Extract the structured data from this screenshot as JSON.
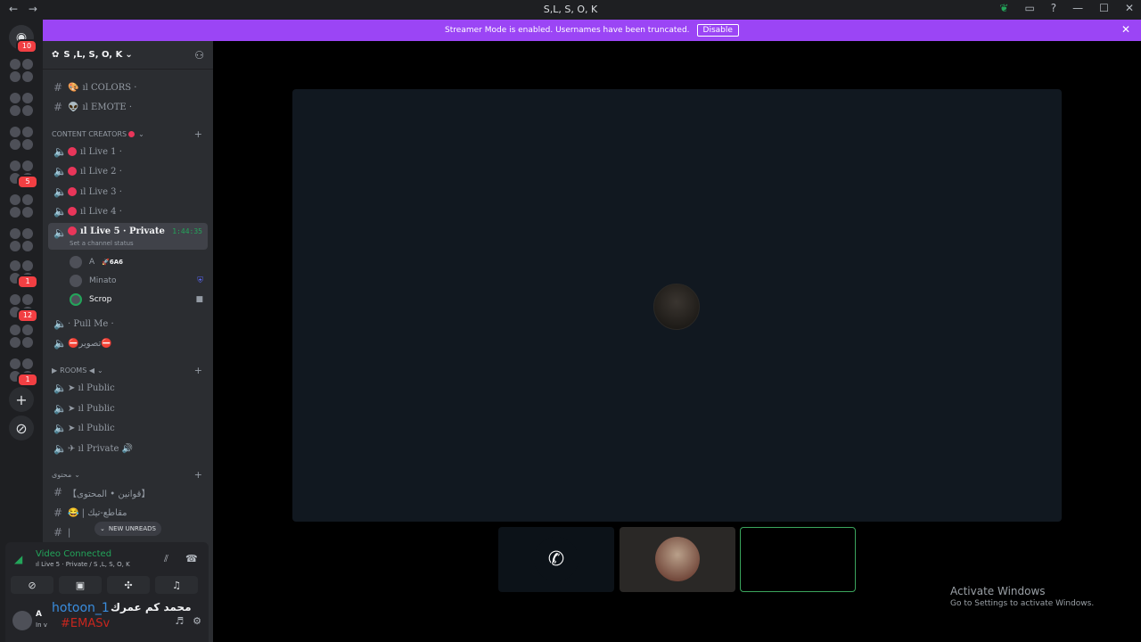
{
  "titlebar": {
    "back": "←",
    "forward": "→",
    "title": "S,L, S, O, K",
    "icons": [
      "leaf-icon",
      "inbox-icon",
      "help-icon"
    ],
    "window_controls": [
      "—",
      "☐",
      "✕"
    ]
  },
  "server_rail": {
    "home_badge": "10",
    "badges": [
      "5",
      "1",
      "12",
      "1"
    ]
  },
  "banner": {
    "text": "Streamer Mode is enabled. Usernames have been truncated.",
    "button": "Disable",
    "close": "✕"
  },
  "server": {
    "name": "S ,L, S, O, K",
    "chevron": "⌄"
  },
  "channels": {
    "text_top": [
      {
        "emoji": "🎨",
        "name": "ıl COLORS ·"
      },
      {
        "emoji": "👽",
        "name": "ıl EMOTE ·"
      }
    ],
    "category_creators": "CONTENT CREATORS",
    "live": [
      {
        "name": "ıl Live 1 ·"
      },
      {
        "name": "ıl Live 2 ·"
      },
      {
        "name": "ıl Live 3 ·"
      },
      {
        "name": "ıl Live 4 ·"
      }
    ],
    "active": {
      "name": "ıl Live 5 · Private",
      "time": "1:44:35",
      "status": "Set a channel status"
    },
    "members": [
      {
        "name": "A",
        "tag": "🚀6A6"
      },
      {
        "name": "Minato"
      },
      {
        "name": "Scrop"
      }
    ],
    "after": [
      {
        "name": "· Pull Me ·"
      },
      {
        "name": "⛔تصوير⛔"
      }
    ],
    "category_rooms": "ROOMS ◀",
    "rooms": [
      {
        "name": "➤ ıl Public"
      },
      {
        "name": "➤ ıl Public"
      },
      {
        "name": "➤ ıl Public"
      },
      {
        "name": "✈ ıl Private 🔊"
      }
    ],
    "category_content": "محتوى",
    "content": [
      {
        "name": "【قوانين • المحتوى】"
      },
      {
        "name": "😂 | مقاطع-تيك"
      },
      {
        "name": "| "
      }
    ],
    "new_unreads": "NEW UNREADS"
  },
  "voice": {
    "title": "Video Connected",
    "subtitle": "ıl Live 5 · Private / S ,L, S, O, K"
  },
  "user": {
    "name": "A",
    "status": "In v",
    "overlay_name": "hotoon_1",
    "overlay_arabic": "محمد كم عمرك",
    "overlay_tag": "#EMASv"
  },
  "watermark": {
    "line1": "Activate Windows",
    "line2": "Go to Settings to activate Windows."
  },
  "colors": {
    "banner": "#9b45f5",
    "connected": "#23a55a",
    "badge": "#f23f43"
  }
}
